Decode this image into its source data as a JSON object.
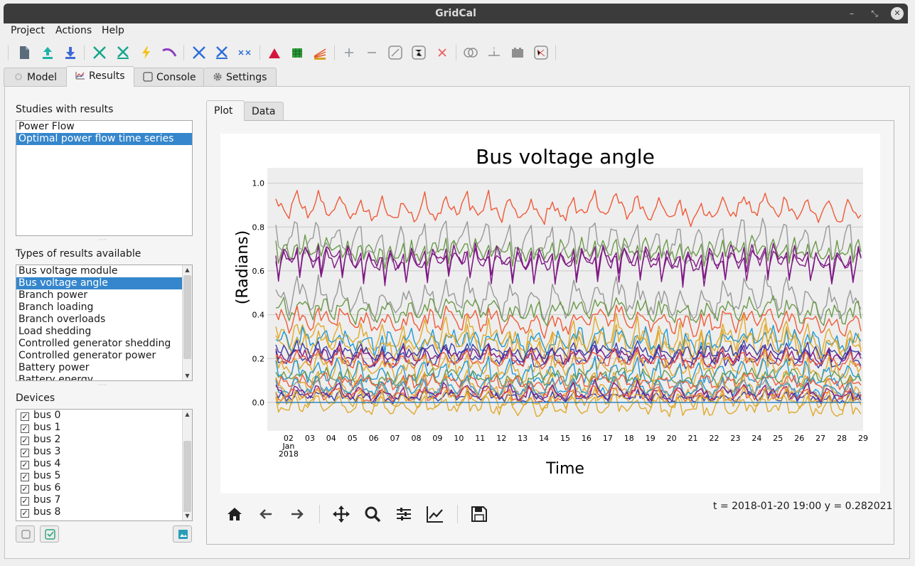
{
  "window": {
    "title": "GridCal"
  },
  "menu": [
    "Project",
    "Actions",
    "Help"
  ],
  "tabs": {
    "model": "Model",
    "results": "Results",
    "console": "Console",
    "settings": "Settings"
  },
  "studies": {
    "label": "Studies with results",
    "items": [
      "Power Flow",
      "Optimal power flow time series"
    ],
    "selected": 1
  },
  "result_types": {
    "label": "Types of results available",
    "items": [
      "Bus voltage module",
      "Bus voltage angle",
      "Branch power",
      "Branch loading",
      "Branch overloads",
      "Load shedding",
      "Controlled generator shedding",
      "Controlled generator power",
      "Battery power",
      "Battery energy"
    ],
    "selected": 1
  },
  "devices": {
    "label": "Devices",
    "check_mark": "✓",
    "items": [
      "bus 0",
      "bus 1",
      "bus 2",
      "bus 3",
      "bus 4",
      "bus 5",
      "bus 6",
      "bus 7",
      "bus 8"
    ]
  },
  "plot_tabs": {
    "plot": "Plot",
    "data": "Data"
  },
  "coords_readout": "t = 2018-01-20 19:00  y = 0.282021",
  "chart_data": {
    "type": "line",
    "title": "Bus voltage angle",
    "xlabel": "Time",
    "ylabel": "(Radians)",
    "x_tick_labels": [
      "02",
      "03",
      "04",
      "05",
      "06",
      "07",
      "08",
      "09",
      "10",
      "11",
      "12",
      "13",
      "14",
      "15",
      "16",
      "17",
      "18",
      "19",
      "20",
      "21",
      "22",
      "23",
      "24",
      "25",
      "26",
      "27",
      "28",
      "29"
    ],
    "x_sub_labels": [
      "Jan",
      "2018"
    ],
    "x_range": [
      "2018-01-01",
      "2018-01-29"
    ],
    "y_ticks": [
      "0.0",
      "0.2",
      "0.4",
      "0.6",
      "0.8",
      "1.0"
    ],
    "ylim": [
      -0.13,
      1.07
    ],
    "grid": true,
    "series": [
      {
        "color": "#f05a38",
        "base": 0.89,
        "amplitude": 0.05,
        "dip": 0.07,
        "noise": 0.025
      },
      {
        "color": "#999999",
        "base": 0.74,
        "amplitude": 0.06,
        "dip": 0.13,
        "noise": 0.03
      },
      {
        "color": "#6c9a4a",
        "base": 0.71,
        "amplitude": 0.04,
        "dip": 0.15,
        "noise": 0.025
      },
      {
        "color": "#7f1a85",
        "base": 0.68,
        "amplitude": 0.04,
        "dip": 0.22,
        "noise": 0.02
      },
      {
        "color": "#7f1a85",
        "base": 0.66,
        "amplitude": 0.04,
        "dip": 0.2,
        "noise": 0.02
      },
      {
        "color": "#999999",
        "base": 0.48,
        "amplitude": 0.07,
        "dip": 0.09,
        "noise": 0.03
      },
      {
        "color": "#6c9a4a",
        "base": 0.43,
        "amplitude": 0.05,
        "dip": 0.08,
        "noise": 0.025
      },
      {
        "color": "#f05a38",
        "base": 0.38,
        "amplitude": 0.05,
        "dip": 0.07,
        "noise": 0.025
      },
      {
        "color": "#e0a92c",
        "base": 0.31,
        "amplitude": 0.06,
        "dip": 0.1,
        "noise": 0.03
      },
      {
        "color": "#1f9ad6",
        "base": 0.29,
        "amplitude": 0.05,
        "dip": 0.09,
        "noise": 0.03
      },
      {
        "color": "#e0a92c",
        "base": 0.27,
        "amplitude": 0.06,
        "dip": 0.11,
        "noise": 0.03
      },
      {
        "color": "#3a3fa8",
        "base": 0.24,
        "amplitude": 0.03,
        "dip": 0.06,
        "noise": 0.02
      },
      {
        "color": "#7f1a85",
        "base": 0.22,
        "amplitude": 0.03,
        "dip": 0.06,
        "noise": 0.02
      },
      {
        "color": "#3a3fa8",
        "base": 0.21,
        "amplitude": 0.03,
        "dip": 0.06,
        "noise": 0.02
      },
      {
        "color": "#f05a38",
        "base": 0.2,
        "amplitude": 0.03,
        "dip": 0.05,
        "noise": 0.02
      },
      {
        "color": "#e0a92c",
        "base": 0.17,
        "amplitude": 0.05,
        "dip": 0.08,
        "noise": 0.03
      },
      {
        "color": "#1f9ad6",
        "base": 0.14,
        "amplitude": 0.04,
        "dip": 0.07,
        "noise": 0.025
      },
      {
        "color": "#6c9a4a",
        "base": 0.12,
        "amplitude": 0.03,
        "dip": 0.05,
        "noise": 0.02
      },
      {
        "color": "#f05a38",
        "base": 0.1,
        "amplitude": 0.03,
        "dip": 0.05,
        "noise": 0.02
      },
      {
        "color": "#e0a92c",
        "base": 0.08,
        "amplitude": 0.04,
        "dip": 0.08,
        "noise": 0.025
      },
      {
        "color": "#1f9ad6",
        "base": 0.07,
        "amplitude": 0.03,
        "dip": 0.04,
        "noise": 0.02
      },
      {
        "color": "#999999",
        "base": 0.06,
        "amplitude": 0.03,
        "dip": 0.04,
        "noise": 0.02
      },
      {
        "color": "#7f1a85",
        "base": 0.05,
        "amplitude": 0.03,
        "dip": 0.05,
        "noise": 0.02
      },
      {
        "color": "#f05a38",
        "base": 0.04,
        "amplitude": 0.02,
        "dip": 0.04,
        "noise": 0.015
      },
      {
        "color": "#3a3fa8",
        "base": 0.03,
        "amplitude": 0.02,
        "dip": 0.04,
        "noise": 0.015
      },
      {
        "color": "#e0a92c",
        "base": 0.02,
        "amplitude": 0.03,
        "dip": 0.06,
        "noise": 0.02
      },
      {
        "color": "#e0a92c",
        "base": -0.01,
        "amplitude": 0.03,
        "dip": 0.06,
        "noise": 0.02
      },
      {
        "color": "#1f7fc4",
        "base": 0.0,
        "amplitude": 0.0,
        "dip": 0.0,
        "noise": 0.0
      }
    ]
  }
}
